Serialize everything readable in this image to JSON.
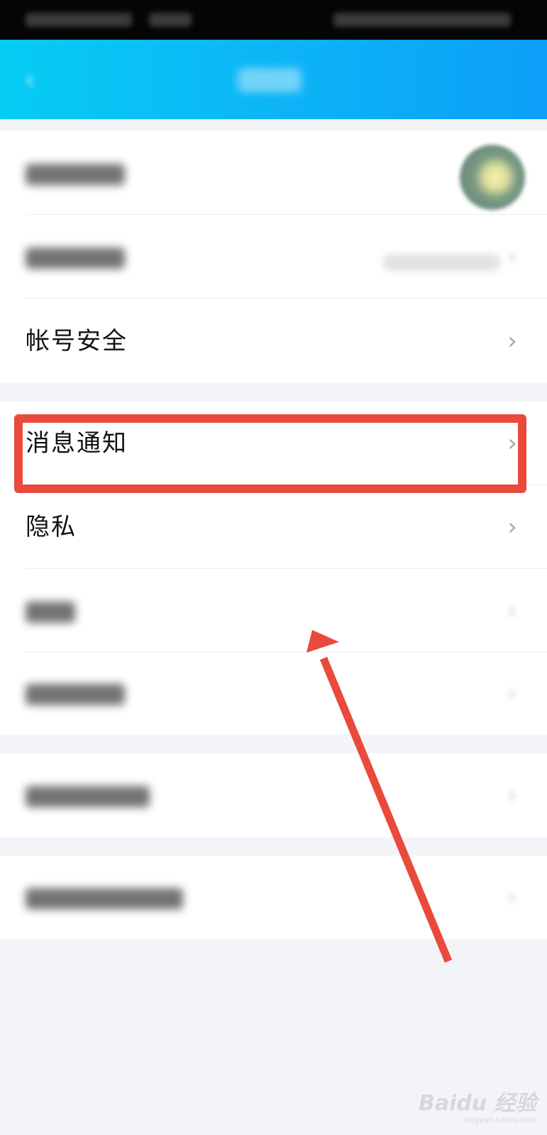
{
  "settings": {
    "rows": {
      "account_security": "帐号安全",
      "message_notification": "消息通知",
      "privacy": "隐私"
    }
  },
  "watermark": {
    "brand": "Baidu 经验",
    "url": "jingyan.baidu.com"
  },
  "colors": {
    "header_gradient_start": "#06cdf4",
    "header_gradient_end": "#0c9ff8",
    "highlight": "#e94a3c",
    "arrow": "#e94a3c",
    "chevron": "#a7a7a7"
  }
}
